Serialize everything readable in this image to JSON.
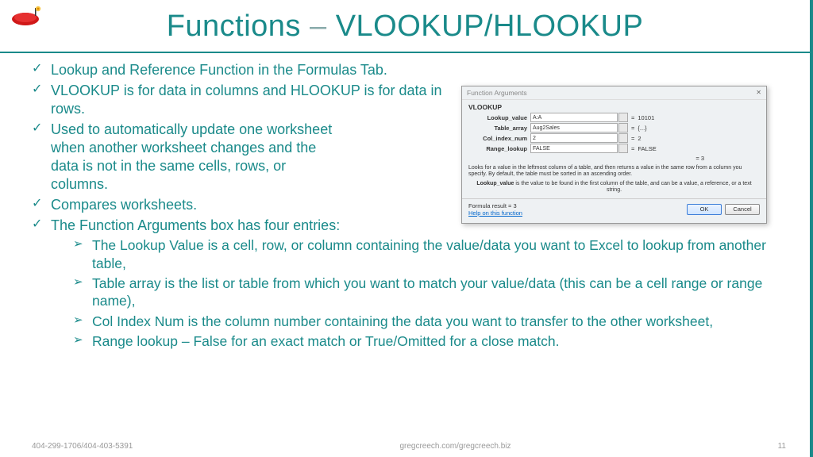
{
  "title_parts": {
    "fn": "Functions",
    "dash": " – ",
    "rest": "VLOOKUP/HLOOKUP"
  },
  "bullets": [
    "Lookup and Reference Function in the Formulas Tab.",
    "VLOOKUP is for data in columns and HLOOKUP is for data in rows.",
    "Used to automatically update one worksheet when another worksheet changes and the data is not in the same cells, rows, or columns.",
    "Compares worksheets.",
    "The Function Arguments box has four entries:"
  ],
  "sub_bullets": [
    "The Lookup Value is a cell, row, or column containing the value/data you want to Excel to lookup from another table,",
    "Table array is the list or table from which you want to match your value/data (this can be a cell range or range name),",
    "Col Index Num is the column number containing the data you want to transfer to the other worksheet,",
    "Range lookup – False for an exact match or True/Omitted for a close match."
  ],
  "dialog": {
    "title": "Function Arguments",
    "func": "VLOOKUP",
    "rows": [
      {
        "label": "Lookup_value",
        "input": "A:A",
        "val": "10101"
      },
      {
        "label": "Table_array",
        "input": "Aug2Sales",
        "val": "{...}"
      },
      {
        "label": "Col_index_num",
        "input": "2",
        "val": "2"
      },
      {
        "label": "Range_lookup",
        "input": "FALSE",
        "val": "FALSE"
      }
    ],
    "result_eq": "= 3",
    "desc": "Looks for a value in the leftmost column of a table, and then returns a value in the same row from a column you specify. By default, the table must be sorted in an ascending order.",
    "desc2_label": "Lookup_value",
    "desc2_text": " is the value to be found in the first column of the table, and can be a value, a reference, or a text string.",
    "formula_result": "Formula result = 3",
    "help": "Help on this function",
    "ok": "OK",
    "cancel": "Cancel"
  },
  "footer": {
    "left": "404-299-1706/404-403-5391",
    "center": "gregcreech.com/gregcreech.biz",
    "right": "11"
  }
}
